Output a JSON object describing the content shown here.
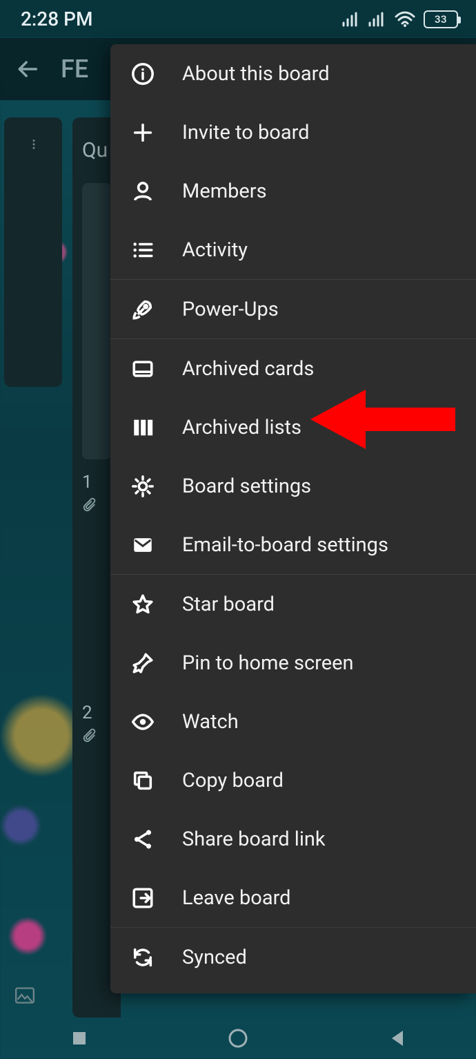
{
  "status": {
    "time": "2:28 PM",
    "battery": "33"
  },
  "toolbar": {
    "title_fragment": "FE"
  },
  "background_column": {
    "header_fragment": "Qu",
    "card1_badge": "1",
    "card2_badge": "2"
  },
  "menu": {
    "items": [
      {
        "icon": "info-icon",
        "label": "About this board"
      },
      {
        "icon": "plus-icon",
        "label": "Invite to board"
      },
      {
        "icon": "person-icon",
        "label": "Members"
      },
      {
        "icon": "list-icon",
        "label": "Activity"
      }
    ],
    "items2": [
      {
        "icon": "rocket-icon",
        "label": "Power-Ups"
      }
    ],
    "items3": [
      {
        "icon": "card-icon",
        "label": "Archived cards"
      },
      {
        "icon": "columns-icon",
        "label": "Archived lists"
      },
      {
        "icon": "gear-icon",
        "label": "Board settings"
      },
      {
        "icon": "mail-icon",
        "label": "Email-to-board settings"
      }
    ],
    "items4": [
      {
        "icon": "star-icon",
        "label": "Star board"
      },
      {
        "icon": "pin-icon",
        "label": "Pin to home screen"
      },
      {
        "icon": "eye-icon",
        "label": "Watch"
      },
      {
        "icon": "copy-icon",
        "label": "Copy board"
      },
      {
        "icon": "share-icon",
        "label": "Share board link"
      },
      {
        "icon": "leave-icon",
        "label": "Leave board"
      }
    ],
    "items5": [
      {
        "icon": "sync-icon",
        "label": "Synced"
      }
    ]
  }
}
